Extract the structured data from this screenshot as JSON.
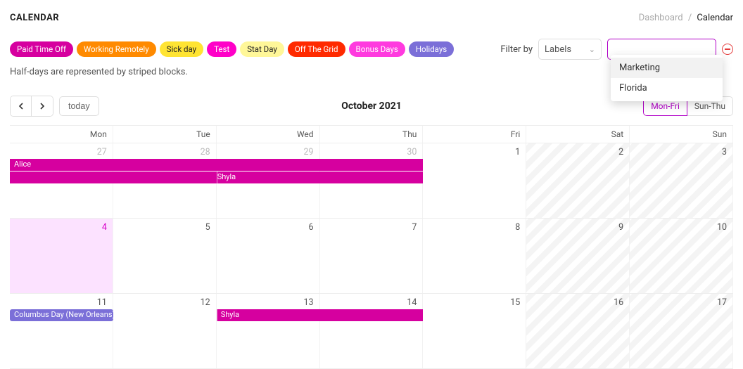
{
  "header": {
    "title": "CALENDAR",
    "breadcrumb": {
      "prev": "Dashboard",
      "sep": "/",
      "current": "Calendar"
    }
  },
  "tags": [
    {
      "label": "Paid Time Off",
      "bg": "#d6009f",
      "fg": "#fff"
    },
    {
      "label": "Working Remotely",
      "bg": "#ff8a00",
      "fg": "#fff"
    },
    {
      "label": "Sick day",
      "bg": "#ffe433",
      "fg": "#222"
    },
    {
      "label": "Test",
      "bg": "#ff00c8",
      "fg": "#fff"
    },
    {
      "label": "Stat Day",
      "bg": "#fff799",
      "fg": "#222"
    },
    {
      "label": "Off The Grid",
      "bg": "#ff2a00",
      "fg": "#fff"
    },
    {
      "label": "Bonus Days",
      "bg": "#ff3adf",
      "fg": "#fff"
    },
    {
      "label": "Holidays",
      "bg": "#7b6fd8",
      "fg": "#fff"
    }
  ],
  "filter": {
    "label": "Filter by",
    "select_value": "Labels",
    "search_value": "",
    "dropdown": [
      "Marketing",
      "Florida"
    ]
  },
  "note": "Half-days are represented by striped blocks.",
  "toolbar": {
    "today": "today",
    "month_label": "October 2021",
    "views": {
      "a": "Mon-Fri",
      "b": "Sun-Thu"
    }
  },
  "dow": [
    "Mon",
    "Tue",
    "Wed",
    "Thu",
    "Fri",
    "Sat",
    "Sun"
  ],
  "weeks": [
    {
      "days": [
        {
          "num": "27",
          "faded": true
        },
        {
          "num": "28",
          "faded": true
        },
        {
          "num": "29",
          "faded": true
        },
        {
          "num": "30",
          "faded": true
        },
        {
          "num": "1"
        },
        {
          "num": "2",
          "weekend": true
        },
        {
          "num": "3",
          "weekend": true
        }
      ],
      "events": [
        {
          "label": "Alice",
          "bg": "#d6009f",
          "row": 0,
          "start": 0,
          "span": 4
        },
        {
          "label": "Shyla",
          "bg": "#d6009f",
          "row": 1,
          "start": 0,
          "span": 4,
          "sep_at": 2
        }
      ]
    },
    {
      "days": [
        {
          "num": "4",
          "today": true
        },
        {
          "num": "5"
        },
        {
          "num": "6"
        },
        {
          "num": "7"
        },
        {
          "num": "8"
        },
        {
          "num": "9",
          "weekend": true
        },
        {
          "num": "10",
          "weekend": true
        }
      ],
      "events": []
    },
    {
      "days": [
        {
          "num": "11"
        },
        {
          "num": "12"
        },
        {
          "num": "13"
        },
        {
          "num": "14"
        },
        {
          "num": "15"
        },
        {
          "num": "16",
          "weekend": true
        },
        {
          "num": "17",
          "weekend": true
        }
      ],
      "events": [
        {
          "label": "Columbus Day (New Orleans)",
          "bg": "#7b6fd8",
          "row": 0,
          "start": 0,
          "span": 1,
          "rounded": true
        },
        {
          "label": "Shyla",
          "bg": "#d6009f",
          "row": 0,
          "start": 2,
          "span": 2,
          "sep_at": 0
        }
      ]
    }
  ]
}
